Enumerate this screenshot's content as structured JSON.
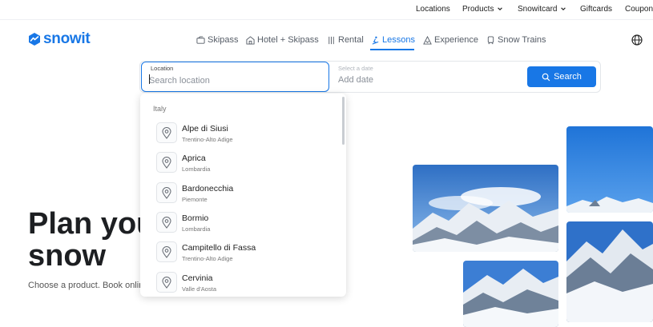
{
  "topbar": {
    "links": [
      "Locations",
      "Products",
      "Snowitcard",
      "Giftcards",
      "Coupon"
    ]
  },
  "brand": {
    "name": "snowit",
    "color": "#1877e6"
  },
  "nav": {
    "items": [
      {
        "label": "Skipass",
        "icon": "skipass-icon"
      },
      {
        "label": "Hotel + Skipass",
        "icon": "hotel-icon"
      },
      {
        "label": "Rental",
        "icon": "rental-icon"
      },
      {
        "label": "Lessons",
        "icon": "lessons-icon",
        "active": true
      },
      {
        "label": "Experience",
        "icon": "experience-icon"
      },
      {
        "label": "Snow Trains",
        "icon": "train-icon"
      }
    ]
  },
  "search": {
    "location_label": "Location",
    "location_placeholder": "Search location",
    "location_value": "",
    "date_label": "Select a date",
    "date_placeholder": "Add date",
    "button_label": "Search"
  },
  "dropdown": {
    "group": "Italy",
    "items": [
      {
        "name": "Alpe di Siusi",
        "region": "Trentino-Alto Adige"
      },
      {
        "name": "Aprica",
        "region": "Lombardia"
      },
      {
        "name": "Bardonecchia",
        "region": "Piemonte"
      },
      {
        "name": "Bormio",
        "region": "Lombardia"
      },
      {
        "name": "Campitello di Fassa",
        "region": "Trentino-Alto Adige"
      },
      {
        "name": "Cervinia",
        "region": "Valle d'Aosta"
      }
    ]
  },
  "hero": {
    "title_line1": "Plan you",
    "title_line2": "snow",
    "subtitle": "Choose a product. Book onlin"
  },
  "colors": {
    "accent": "#1877e6",
    "text": "#1d1f22",
    "muted": "#8a9099"
  }
}
